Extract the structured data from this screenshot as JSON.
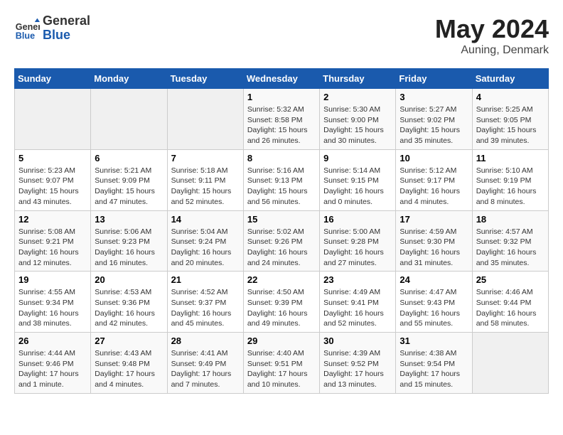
{
  "header": {
    "logo_general": "General",
    "logo_blue": "Blue",
    "month_year": "May 2024",
    "location": "Auning, Denmark"
  },
  "days_of_week": [
    "Sunday",
    "Monday",
    "Tuesday",
    "Wednesday",
    "Thursday",
    "Friday",
    "Saturday"
  ],
  "weeks": [
    [
      {
        "day": "",
        "sunrise": "",
        "sunset": "",
        "daylight": "",
        "empty": true
      },
      {
        "day": "",
        "sunrise": "",
        "sunset": "",
        "daylight": "",
        "empty": true
      },
      {
        "day": "",
        "sunrise": "",
        "sunset": "",
        "daylight": "",
        "empty": true
      },
      {
        "day": "1",
        "sunrise": "Sunrise: 5:32 AM",
        "sunset": "Sunset: 8:58 PM",
        "daylight": "Daylight: 15 hours and 26 minutes."
      },
      {
        "day": "2",
        "sunrise": "Sunrise: 5:30 AM",
        "sunset": "Sunset: 9:00 PM",
        "daylight": "Daylight: 15 hours and 30 minutes."
      },
      {
        "day": "3",
        "sunrise": "Sunrise: 5:27 AM",
        "sunset": "Sunset: 9:02 PM",
        "daylight": "Daylight: 15 hours and 35 minutes."
      },
      {
        "day": "4",
        "sunrise": "Sunrise: 5:25 AM",
        "sunset": "Sunset: 9:05 PM",
        "daylight": "Daylight: 15 hours and 39 minutes."
      }
    ],
    [
      {
        "day": "5",
        "sunrise": "Sunrise: 5:23 AM",
        "sunset": "Sunset: 9:07 PM",
        "daylight": "Daylight: 15 hours and 43 minutes."
      },
      {
        "day": "6",
        "sunrise": "Sunrise: 5:21 AM",
        "sunset": "Sunset: 9:09 PM",
        "daylight": "Daylight: 15 hours and 47 minutes."
      },
      {
        "day": "7",
        "sunrise": "Sunrise: 5:18 AM",
        "sunset": "Sunset: 9:11 PM",
        "daylight": "Daylight: 15 hours and 52 minutes."
      },
      {
        "day": "8",
        "sunrise": "Sunrise: 5:16 AM",
        "sunset": "Sunset: 9:13 PM",
        "daylight": "Daylight: 15 hours and 56 minutes."
      },
      {
        "day": "9",
        "sunrise": "Sunrise: 5:14 AM",
        "sunset": "Sunset: 9:15 PM",
        "daylight": "Daylight: 16 hours and 0 minutes."
      },
      {
        "day": "10",
        "sunrise": "Sunrise: 5:12 AM",
        "sunset": "Sunset: 9:17 PM",
        "daylight": "Daylight: 16 hours and 4 minutes."
      },
      {
        "day": "11",
        "sunrise": "Sunrise: 5:10 AM",
        "sunset": "Sunset: 9:19 PM",
        "daylight": "Daylight: 16 hours and 8 minutes."
      }
    ],
    [
      {
        "day": "12",
        "sunrise": "Sunrise: 5:08 AM",
        "sunset": "Sunset: 9:21 PM",
        "daylight": "Daylight: 16 hours and 12 minutes."
      },
      {
        "day": "13",
        "sunrise": "Sunrise: 5:06 AM",
        "sunset": "Sunset: 9:23 PM",
        "daylight": "Daylight: 16 hours and 16 minutes."
      },
      {
        "day": "14",
        "sunrise": "Sunrise: 5:04 AM",
        "sunset": "Sunset: 9:24 PM",
        "daylight": "Daylight: 16 hours and 20 minutes."
      },
      {
        "day": "15",
        "sunrise": "Sunrise: 5:02 AM",
        "sunset": "Sunset: 9:26 PM",
        "daylight": "Daylight: 16 hours and 24 minutes."
      },
      {
        "day": "16",
        "sunrise": "Sunrise: 5:00 AM",
        "sunset": "Sunset: 9:28 PM",
        "daylight": "Daylight: 16 hours and 27 minutes."
      },
      {
        "day": "17",
        "sunrise": "Sunrise: 4:59 AM",
        "sunset": "Sunset: 9:30 PM",
        "daylight": "Daylight: 16 hours and 31 minutes."
      },
      {
        "day": "18",
        "sunrise": "Sunrise: 4:57 AM",
        "sunset": "Sunset: 9:32 PM",
        "daylight": "Daylight: 16 hours and 35 minutes."
      }
    ],
    [
      {
        "day": "19",
        "sunrise": "Sunrise: 4:55 AM",
        "sunset": "Sunset: 9:34 PM",
        "daylight": "Daylight: 16 hours and 38 minutes."
      },
      {
        "day": "20",
        "sunrise": "Sunrise: 4:53 AM",
        "sunset": "Sunset: 9:36 PM",
        "daylight": "Daylight: 16 hours and 42 minutes."
      },
      {
        "day": "21",
        "sunrise": "Sunrise: 4:52 AM",
        "sunset": "Sunset: 9:37 PM",
        "daylight": "Daylight: 16 hours and 45 minutes."
      },
      {
        "day": "22",
        "sunrise": "Sunrise: 4:50 AM",
        "sunset": "Sunset: 9:39 PM",
        "daylight": "Daylight: 16 hours and 49 minutes."
      },
      {
        "day": "23",
        "sunrise": "Sunrise: 4:49 AM",
        "sunset": "Sunset: 9:41 PM",
        "daylight": "Daylight: 16 hours and 52 minutes."
      },
      {
        "day": "24",
        "sunrise": "Sunrise: 4:47 AM",
        "sunset": "Sunset: 9:43 PM",
        "daylight": "Daylight: 16 hours and 55 minutes."
      },
      {
        "day": "25",
        "sunrise": "Sunrise: 4:46 AM",
        "sunset": "Sunset: 9:44 PM",
        "daylight": "Daylight: 16 hours and 58 minutes."
      }
    ],
    [
      {
        "day": "26",
        "sunrise": "Sunrise: 4:44 AM",
        "sunset": "Sunset: 9:46 PM",
        "daylight": "Daylight: 17 hours and 1 minute."
      },
      {
        "day": "27",
        "sunrise": "Sunrise: 4:43 AM",
        "sunset": "Sunset: 9:48 PM",
        "daylight": "Daylight: 17 hours and 4 minutes."
      },
      {
        "day": "28",
        "sunrise": "Sunrise: 4:41 AM",
        "sunset": "Sunset: 9:49 PM",
        "daylight": "Daylight: 17 hours and 7 minutes."
      },
      {
        "day": "29",
        "sunrise": "Sunrise: 4:40 AM",
        "sunset": "Sunset: 9:51 PM",
        "daylight": "Daylight: 17 hours and 10 minutes."
      },
      {
        "day": "30",
        "sunrise": "Sunrise: 4:39 AM",
        "sunset": "Sunset: 9:52 PM",
        "daylight": "Daylight: 17 hours and 13 minutes."
      },
      {
        "day": "31",
        "sunrise": "Sunrise: 4:38 AM",
        "sunset": "Sunset: 9:54 PM",
        "daylight": "Daylight: 17 hours and 15 minutes."
      },
      {
        "day": "",
        "sunrise": "",
        "sunset": "",
        "daylight": "",
        "empty": true
      }
    ]
  ]
}
